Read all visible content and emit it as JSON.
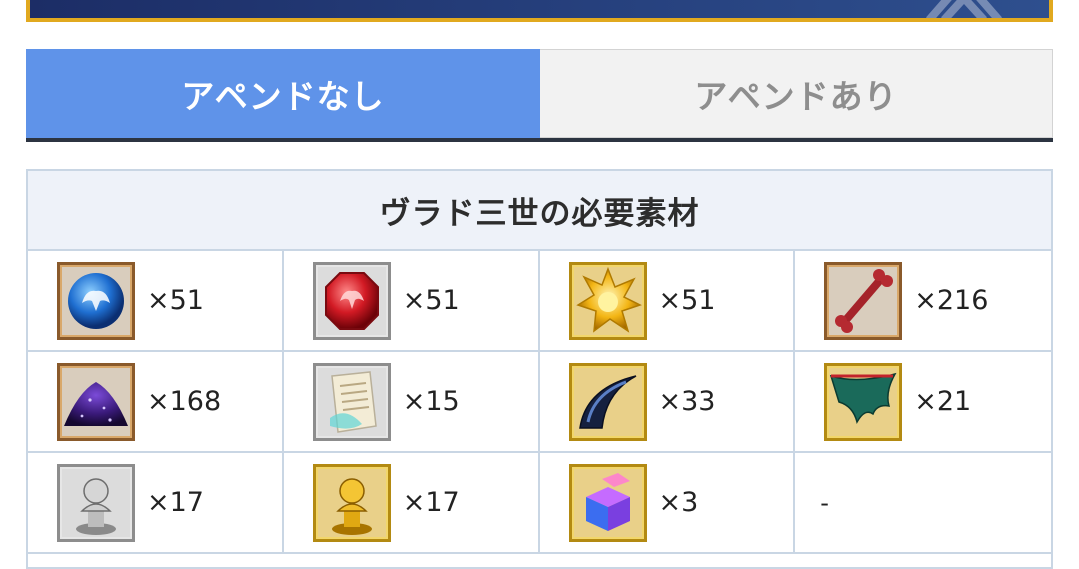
{
  "tabs": [
    {
      "label": "アペンドなし",
      "active": true
    },
    {
      "label": "アペンドあり",
      "active": false
    }
  ],
  "materials": {
    "title": "ヴラド三世の必要素材",
    "items": [
      {
        "icon": "blue-orb-gem-icon",
        "quantity": "×51"
      },
      {
        "icon": "red-magic-stone-icon",
        "quantity": "×51"
      },
      {
        "icon": "gold-star-piece-icon",
        "quantity": "×51"
      },
      {
        "icon": "bone-icon",
        "quantity": "×216"
      },
      {
        "icon": "purple-dust-pile-icon",
        "quantity": "×168"
      },
      {
        "icon": "scroll-page-icon",
        "quantity": "×15"
      },
      {
        "icon": "dark-claw-icon",
        "quantity": "×33"
      },
      {
        "icon": "green-wing-icon",
        "quantity": "×21"
      },
      {
        "icon": "silver-statue-icon",
        "quantity": "×17"
      },
      {
        "icon": "gold-statue-icon",
        "quantity": "×17"
      },
      {
        "icon": "prism-cube-icon",
        "quantity": "×3"
      }
    ],
    "empty_cell": "-"
  },
  "colors": {
    "tab_active": "#5f93e9",
    "tab_inactive": "#f2f2f2",
    "table_border": "#c9d6e4",
    "title_bg": "#eef2f9",
    "banner": "#26407d",
    "banner_border": "#e1a91f"
  }
}
